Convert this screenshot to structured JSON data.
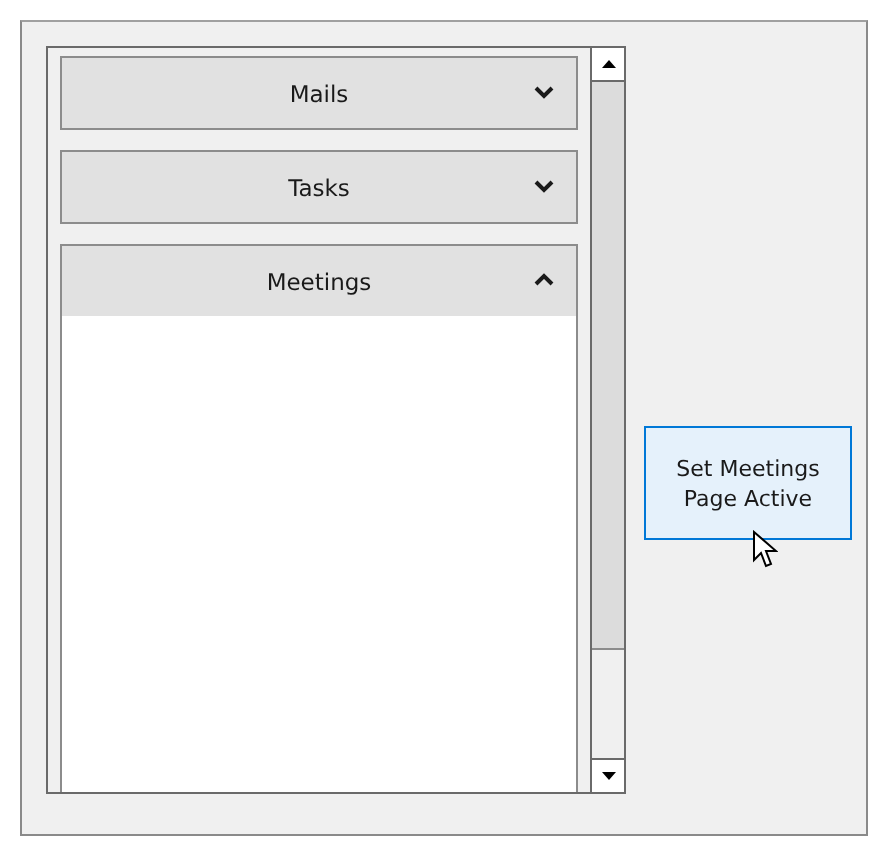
{
  "accordion": {
    "items": [
      {
        "title": "Mails",
        "expanded": false
      },
      {
        "title": "Tasks",
        "expanded": false
      },
      {
        "title": "Meetings",
        "expanded": true
      }
    ]
  },
  "button": {
    "label": "Set Meetings Page Active",
    "hovered": true
  }
}
